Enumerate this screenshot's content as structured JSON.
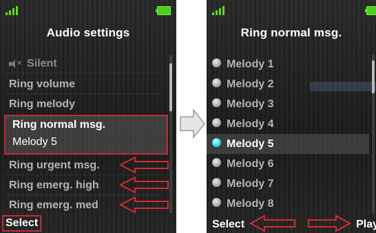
{
  "colors": {
    "highlight_outline": "#c6283a",
    "signal_green": "#5ce01e",
    "battery_green": "#4ccf1a",
    "radio_selected": "#3fe5ea",
    "annotation_arrow": "#d42a36"
  },
  "left_screen": {
    "title": "Audio settings",
    "items": [
      {
        "label": "Silent",
        "icon": "speaker-muted-icon",
        "dimmed": true
      },
      {
        "label": "Ring volume"
      },
      {
        "label": "Ring melody"
      },
      {
        "label": "Ring normal msg.",
        "value": "Melody 5",
        "selected": true
      },
      {
        "label": "Ring urgent msg."
      },
      {
        "label": "Ring emerg. high"
      },
      {
        "label": "Ring emerg. med"
      }
    ],
    "softkeys": {
      "left": "Select"
    }
  },
  "right_screen": {
    "title": "Ring normal msg.",
    "options": [
      {
        "label": "Melody 1",
        "checked": false
      },
      {
        "label": "Melody 2",
        "checked": false
      },
      {
        "label": "Melody 3",
        "checked": false
      },
      {
        "label": "Melody 4",
        "checked": false
      },
      {
        "label": "Melody 5",
        "checked": true
      },
      {
        "label": "Melody 6",
        "checked": false
      },
      {
        "label": "Melody 7",
        "checked": false
      },
      {
        "label": "Melody 8",
        "checked": false
      }
    ],
    "softkeys": {
      "left": "Select",
      "right": "Play"
    }
  }
}
